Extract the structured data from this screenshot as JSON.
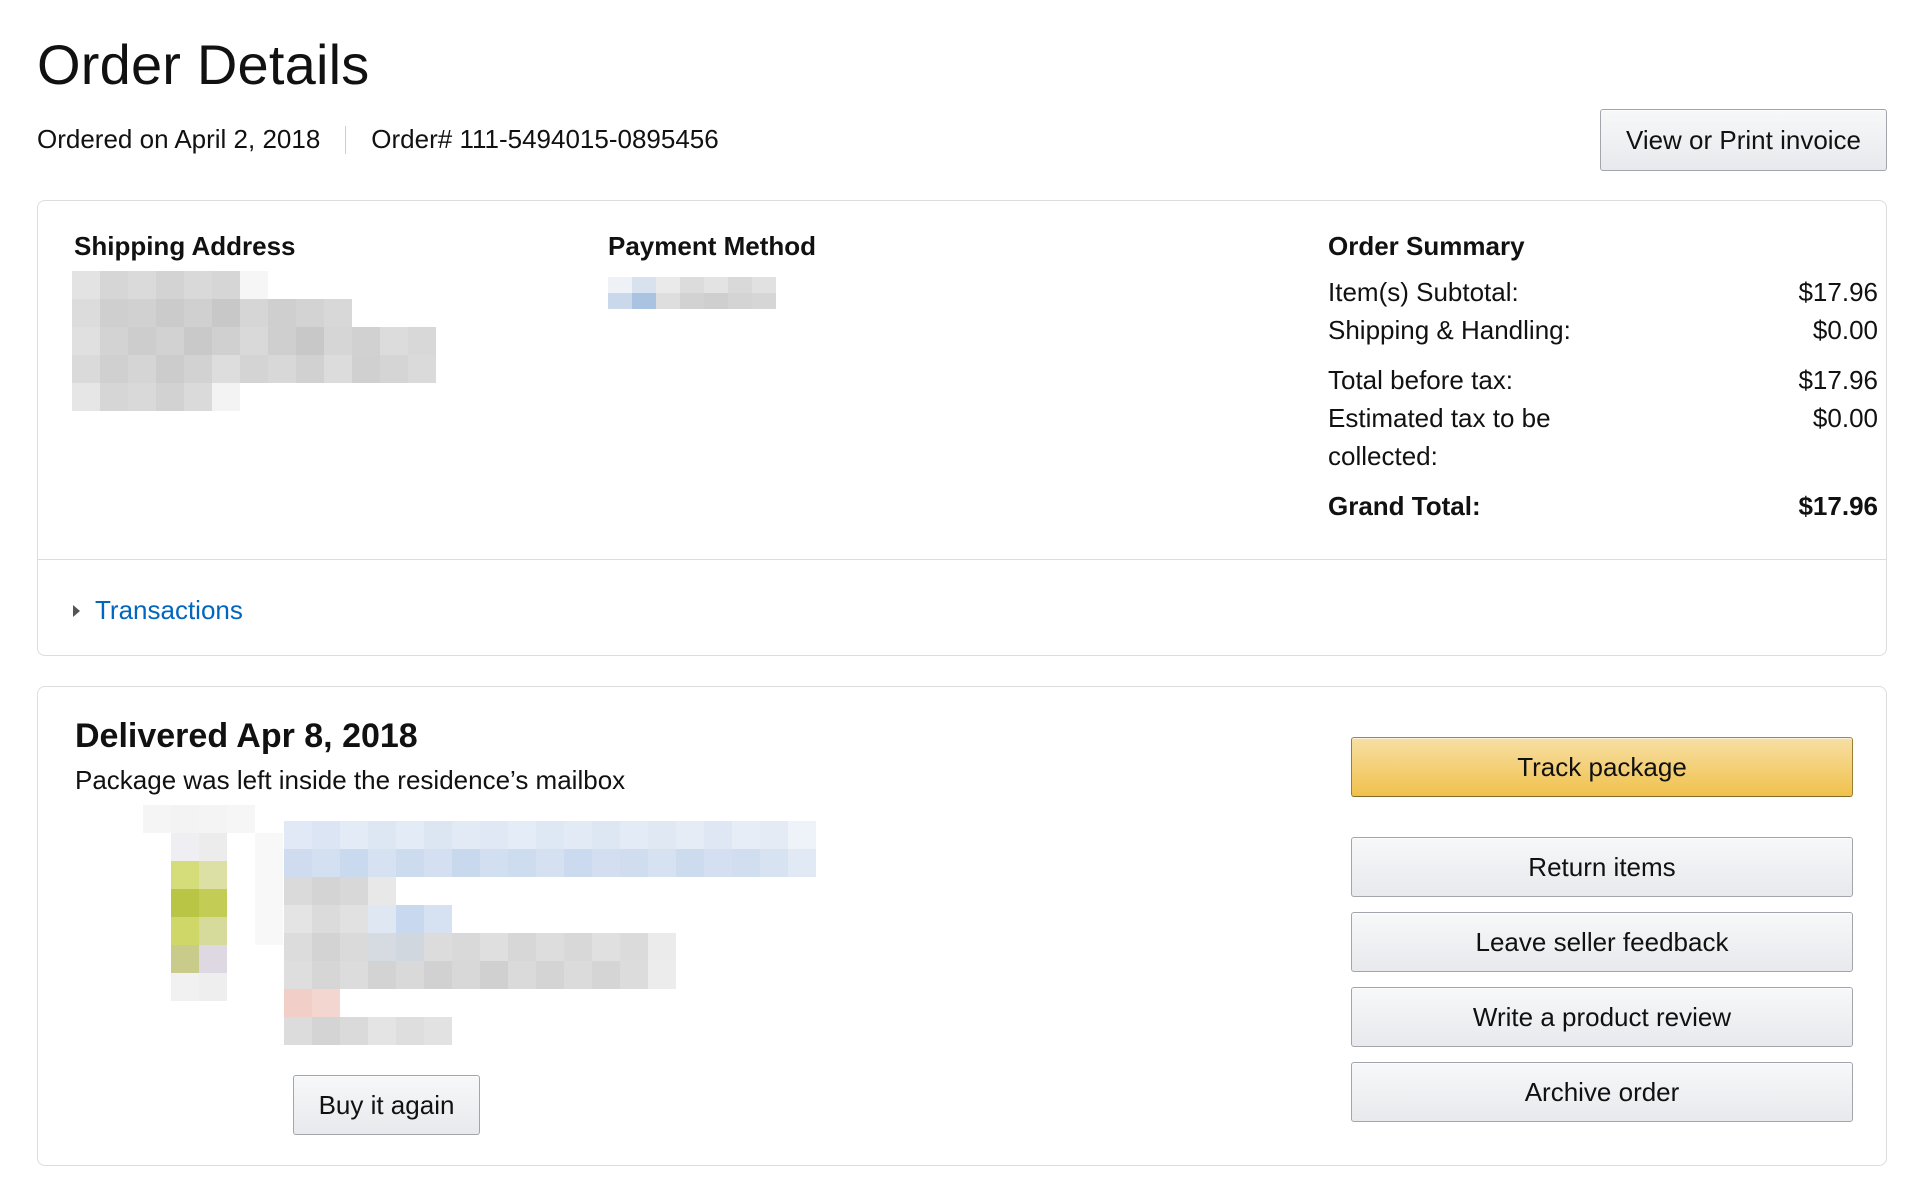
{
  "header": {
    "title": "Order Details",
    "ordered_on": "Ordered on April 2, 2018",
    "order_number": "Order# 111-5494015-0895456",
    "invoice_button": "View or Print invoice"
  },
  "shipping": {
    "heading": "Shipping Address"
  },
  "payment": {
    "heading": "Payment Method"
  },
  "summary": {
    "heading": "Order Summary",
    "rows": [
      {
        "label": "Item(s) Subtotal:",
        "value": "$17.96"
      },
      {
        "label": "Shipping & Handling:",
        "value": "$0.00"
      },
      {
        "label": "Total before tax:",
        "value": "$17.96"
      },
      {
        "label": "Estimated tax to be collected:",
        "value": "$0.00"
      }
    ],
    "grand_total_label": "Grand Total:",
    "grand_total_value": "$17.96"
  },
  "transactions": {
    "label": "Transactions"
  },
  "shipment": {
    "status": "Delivered Apr 8, 2018",
    "note": "Package was left inside the residence’s mailbox",
    "buy_again": "Buy it again"
  },
  "actions": {
    "track": "Track package",
    "return": "Return items",
    "feedback": "Leave seller feedback",
    "review": "Write a product review",
    "archive": "Archive order"
  },
  "colors": {
    "link": "#0066c0",
    "primary_button": "#f0c14b",
    "border": "#dddddd"
  }
}
